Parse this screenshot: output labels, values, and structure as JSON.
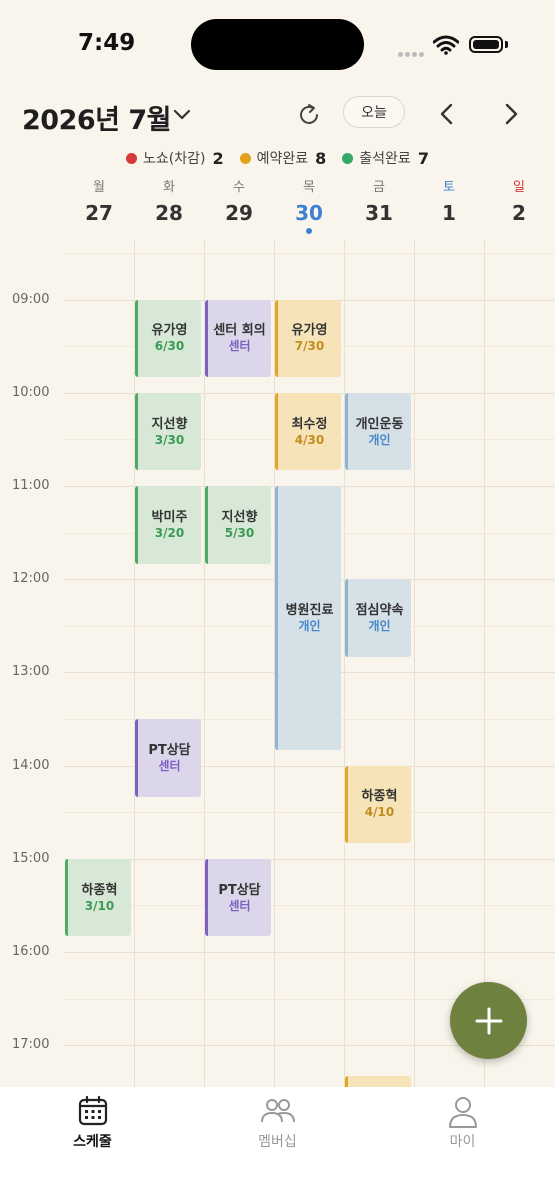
{
  "status_bar": {
    "time": "7:49"
  },
  "header": {
    "month_title": "2026년 7월",
    "today_label": "오늘",
    "icons": [
      "chevron-down-icon",
      "refresh-icon",
      "chevron-left-icon",
      "chevron-right-icon"
    ]
  },
  "legend": [
    {
      "label": "노쇼(차감)",
      "count": "2",
      "color": "#d63a3a"
    },
    {
      "label": "예약완료",
      "count": "8",
      "color": "#e3a21b"
    },
    {
      "label": "출석완료",
      "count": "7",
      "color": "#34a865"
    }
  ],
  "days": [
    {
      "dow": "월",
      "date": "27",
      "dow_color": "#777777",
      "date_color": "#333333",
      "today": false
    },
    {
      "dow": "화",
      "date": "28",
      "dow_color": "#777777",
      "date_color": "#333333",
      "today": false
    },
    {
      "dow": "수",
      "date": "29",
      "dow_color": "#777777",
      "date_color": "#333333",
      "today": false
    },
    {
      "dow": "목",
      "date": "30",
      "dow_color": "#777777",
      "date_color": "#3d7fd1",
      "today": true
    },
    {
      "dow": "금",
      "date": "31",
      "dow_color": "#777777",
      "date_color": "#333333",
      "today": false
    },
    {
      "dow": "토",
      "date": "1",
      "dow_color": "#3d7fd1",
      "date_color": "#333333",
      "today": false
    },
    {
      "dow": "일",
      "date": "2",
      "dow_color": "#d63a3a",
      "date_color": "#333333",
      "today": false
    }
  ],
  "time_labels": [
    "09:00",
    "10:00",
    "11:00",
    "12:00",
    "13:00",
    "14:00",
    "15:00",
    "16:00",
    "17:00"
  ],
  "events": [
    {
      "day": 1,
      "start": "09:00",
      "end": "09:50",
      "title": "유가영",
      "subtitle": "6/30",
      "kind": "green"
    },
    {
      "day": 2,
      "start": "09:00",
      "end": "09:50",
      "title": "센터 회의",
      "subtitle": "센터",
      "kind": "purple"
    },
    {
      "day": 3,
      "start": "09:00",
      "end": "09:50",
      "title": "유가영",
      "subtitle": "7/30",
      "kind": "orange"
    },
    {
      "day": 1,
      "start": "10:00",
      "end": "10:50",
      "title": "지선향",
      "subtitle": "3/30",
      "kind": "green"
    },
    {
      "day": 3,
      "start": "10:00",
      "end": "10:50",
      "title": "최수정",
      "subtitle": "4/30",
      "kind": "orange"
    },
    {
      "day": 4,
      "start": "10:00",
      "end": "10:50",
      "title": "개인운동",
      "subtitle": "개인",
      "kind": "blue"
    },
    {
      "day": 1,
      "start": "11:00",
      "end": "11:50",
      "title": "박미주",
      "subtitle": "3/20",
      "kind": "green"
    },
    {
      "day": 2,
      "start": "11:00",
      "end": "11:50",
      "title": "지선향",
      "subtitle": "5/30",
      "kind": "green"
    },
    {
      "day": 3,
      "start": "11:00",
      "end": "13:50",
      "title": "병원진료",
      "subtitle": "개인",
      "kind": "blue"
    },
    {
      "day": 4,
      "start": "12:00",
      "end": "12:50",
      "title": "점심약속",
      "subtitle": "개인",
      "kind": "blue"
    },
    {
      "day": 1,
      "start": "13:30",
      "end": "14:20",
      "title": "PT상담",
      "subtitle": "센터",
      "kind": "purple"
    },
    {
      "day": 4,
      "start": "14:00",
      "end": "14:50",
      "title": "하종혁",
      "subtitle": "4/10",
      "kind": "orange"
    },
    {
      "day": 0,
      "start": "15:00",
      "end": "15:50",
      "title": "하종혁",
      "subtitle": "3/10",
      "kind": "green"
    },
    {
      "day": 2,
      "start": "15:00",
      "end": "15:50",
      "title": "PT상담",
      "subtitle": "센터",
      "kind": "purple"
    },
    {
      "day": 4,
      "start": "17:20",
      "end": "18:00",
      "title": "",
      "subtitle": "",
      "kind": "orange"
    }
  ],
  "fab_icon": "plus-icon",
  "tabs": [
    {
      "label": "스케줄",
      "icon": "calendar-icon",
      "active": true
    },
    {
      "label": "멤버십",
      "icon": "members-icon",
      "active": false
    },
    {
      "label": "마이",
      "icon": "person-icon",
      "active": false
    }
  ]
}
